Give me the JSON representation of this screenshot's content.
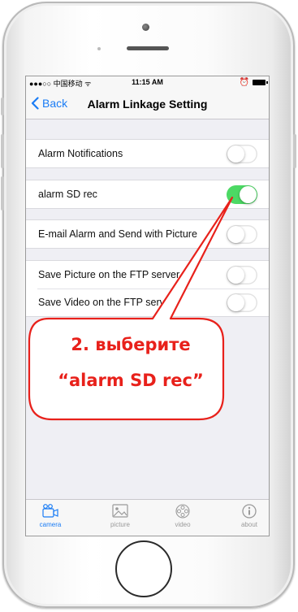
{
  "status_bar": {
    "carrier": "●●●○○ 中国移动 ᯤ",
    "time": "11:15 AM",
    "alarm_icon": "⏰"
  },
  "nav": {
    "back_label": "Back",
    "title": "Alarm Linkage Setting"
  },
  "settings": [
    {
      "label": "Alarm Notifications",
      "on": false
    },
    {
      "label": "alarm SD rec",
      "on": true
    },
    {
      "label": "E-mail Alarm and Send with Picture",
      "on": false
    },
    {
      "label": "Save Picture on the FTP server",
      "on": false
    },
    {
      "label": "Save Video on the FTP server",
      "on": false
    }
  ],
  "tabs": [
    {
      "label": "camera",
      "icon": "camera-icon",
      "active": true
    },
    {
      "label": "picture",
      "icon": "picture-icon",
      "active": false
    },
    {
      "label": "video",
      "icon": "video-icon",
      "active": false
    },
    {
      "label": "about",
      "icon": "info-icon",
      "active": false
    }
  ],
  "callout": {
    "line1": "2. выберите",
    "line2": "“alarm SD rec”",
    "color": "#e8211b"
  },
  "colors": {
    "accent": "#1a7cf5",
    "toggle_on": "#4cd964"
  }
}
